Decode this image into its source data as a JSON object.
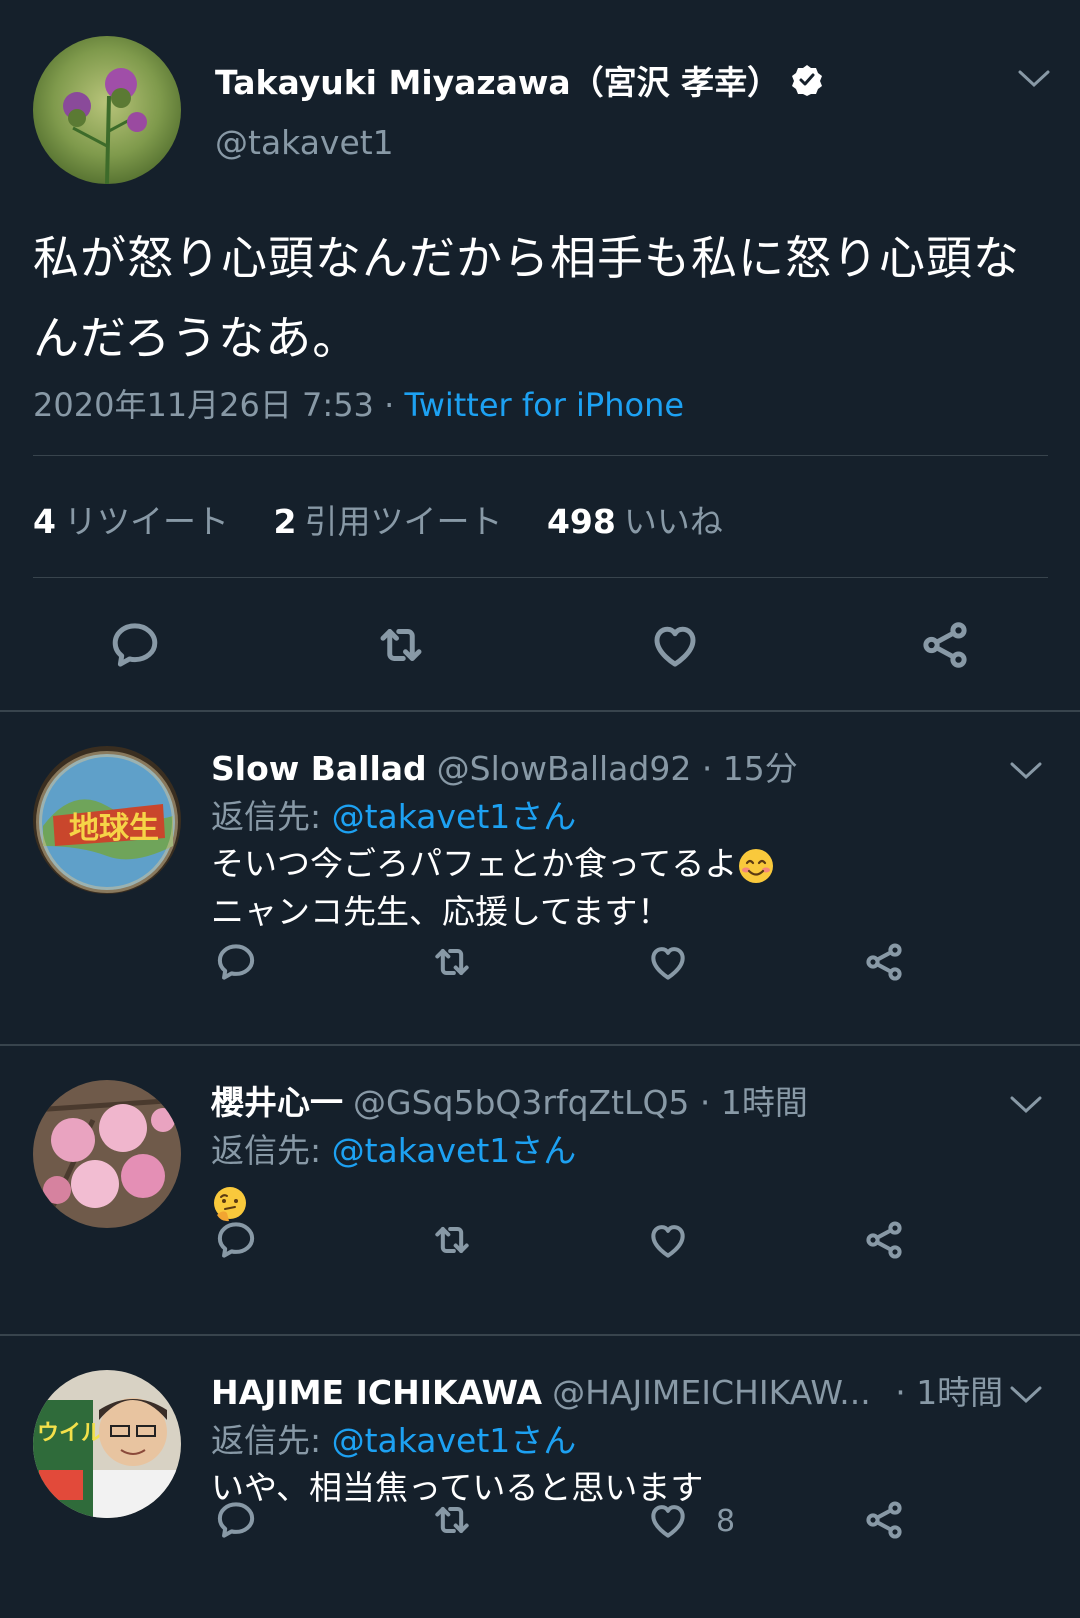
{
  "main_tweet": {
    "display_name": "Takayuki Miyazawa（宮沢 孝幸）",
    "handle": "@takavet1",
    "text": "私が怒り心頭なんだから相手も私に怒り心頭なんだろうなあ。",
    "timestamp": "2020年11月26日 7:53 · ",
    "source": "Twitter for iPhone",
    "stats": {
      "retweets": "4",
      "retweets_label": "リツイート",
      "quotes": "2",
      "quotes_label": "引用ツイート",
      "likes": "498",
      "likes_label": "いいね"
    }
  },
  "replies": [
    {
      "name": "Slow Ballad",
      "handle": "@SlowBallad92",
      "time": " · 15分",
      "reply_prefix": "返信先: ",
      "reply_to": "@takavet1さん",
      "line1": "そいつ今ごろパフェとか食ってるよ",
      "line2": "ニャンコ先生、応援してます！",
      "emoji": "smiling-face-emoji",
      "like_count": ""
    },
    {
      "name": "櫻井心一",
      "handle": "@GSq5bQ3rfqZtLQ5",
      "time": " · 1時間",
      "reply_prefix": "返信先: ",
      "reply_to": "@takavet1さん",
      "emoji": "thinking-face-emoji",
      "like_count": ""
    },
    {
      "name": "HAJIME ICHIKAWA",
      "handle": "@HAJIMEICHIKAW...",
      "time": " · 1時間",
      "reply_prefix": "返信先: ",
      "reply_to": "@takavet1さん",
      "line1": "いや、相当焦っていると思います",
      "like_count": "8"
    }
  ],
  "icons": {
    "reply": "reply-icon",
    "retweet": "retweet-icon",
    "like": "heart-icon",
    "share": "share-icon",
    "menu": "chevron-down-icon",
    "verified": "verified-badge-icon"
  },
  "colors": {
    "background": "#15202b",
    "accent": "#1da1f2",
    "secondary_text": "#8899a6",
    "divider": "#38444d"
  }
}
